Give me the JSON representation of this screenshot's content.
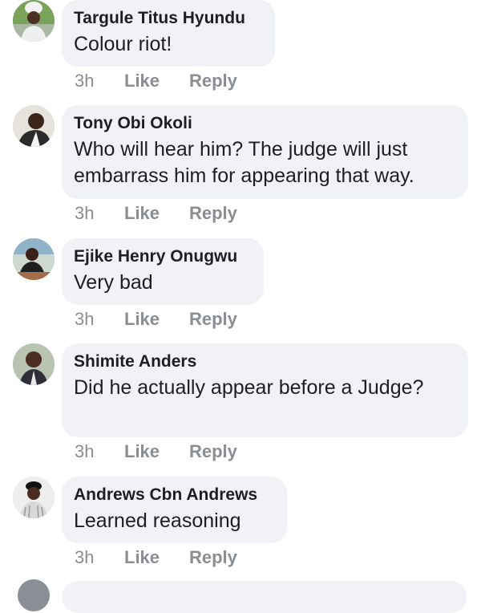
{
  "comments": [
    {
      "author": "Targule Titus Hyundu",
      "text": "Colour riot!",
      "time": "3h",
      "like": "Like",
      "reply": "Reply",
      "avatar": "avatar-white-cap-man"
    },
    {
      "author": "Tony Obi Okoli",
      "text": "Who will hear him? The judge will just embarrass him for appearing that way.",
      "time": "3h",
      "like": "Like",
      "reply": "Reply",
      "avatar": "avatar-suited-man"
    },
    {
      "author": "Ejike Henry Onugwu",
      "text": "Very bad",
      "time": "3h",
      "like": "Like",
      "reply": "Reply",
      "avatar": "avatar-seated-man"
    },
    {
      "author": "Shimite Anders",
      "text": "Did he actually appear before a Judge?",
      "time": "3h",
      "like": "Like",
      "reply": "Reply",
      "avatar": "avatar-man-in-suit"
    },
    {
      "author": "Andrews Cbn Andrews",
      "text": "Learned reasoning",
      "time": "3h",
      "like": "Like",
      "reply": "Reply",
      "avatar": "avatar-man-black-cap"
    }
  ],
  "colors": {
    "bubble": "#f0f2f5",
    "meta": "#8a8d91",
    "text": "#1c1e21"
  }
}
